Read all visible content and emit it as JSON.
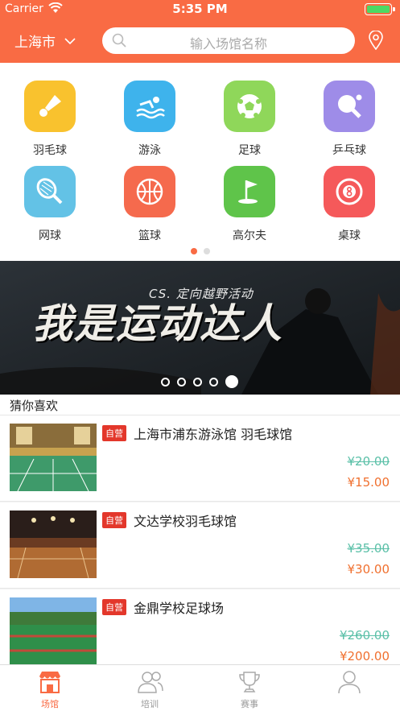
{
  "status": {
    "carrier": "Carrier",
    "time": "5:35 PM"
  },
  "header": {
    "city": "上海市",
    "search_placeholder": "输入场馆名称"
  },
  "categories": [
    {
      "label": "羽毛球",
      "icon": "shuttlecock-icon",
      "color": "#f9c22e"
    },
    {
      "label": "游泳",
      "icon": "swimming-icon",
      "color": "#3eb3ec"
    },
    {
      "label": "足球",
      "icon": "football-icon",
      "color": "#8fd75a"
    },
    {
      "label": "乒乓球",
      "icon": "pingpong-icon",
      "color": "#9e8ce8"
    },
    {
      "label": "网球",
      "icon": "tennis-icon",
      "color": "#63c2e6"
    },
    {
      "label": "篮球",
      "icon": "basketball-icon",
      "color": "#f56a4d"
    },
    {
      "label": "高尔夫",
      "icon": "golf-icon",
      "color": "#5fc44a"
    },
    {
      "label": "桌球",
      "icon": "billiards-icon",
      "color": "#f5595a"
    }
  ],
  "banner": {
    "headline": "我是运动达人",
    "subtitle": "CS. 定向越野活动"
  },
  "section": {
    "title": "猜你喜欢"
  },
  "venues": [
    {
      "tag": "自营",
      "name": "上海市浦东游泳馆 羽毛球馆",
      "old_price": "¥20.00",
      "price": "¥15.00"
    },
    {
      "tag": "自营",
      "name": "文达学校羽毛球馆",
      "old_price": "¥35.00",
      "price": "¥30.00"
    },
    {
      "tag": "自营",
      "name": "金鼎学校足球场",
      "old_price": "¥260.00",
      "price": "¥200.00"
    }
  ],
  "tabs": [
    {
      "label": "场馆",
      "icon": "venue-icon",
      "active": true
    },
    {
      "label": "培训",
      "icon": "training-icon",
      "active": false
    },
    {
      "label": "赛事",
      "icon": "trophy-icon",
      "active": false
    },
    {
      "label": "",
      "icon": "user-icon",
      "active": false
    }
  ],
  "colors": {
    "accent": "#f96b44",
    "old_price": "#5bc0a8",
    "price": "#f0702f",
    "tag": "#e3372b"
  }
}
